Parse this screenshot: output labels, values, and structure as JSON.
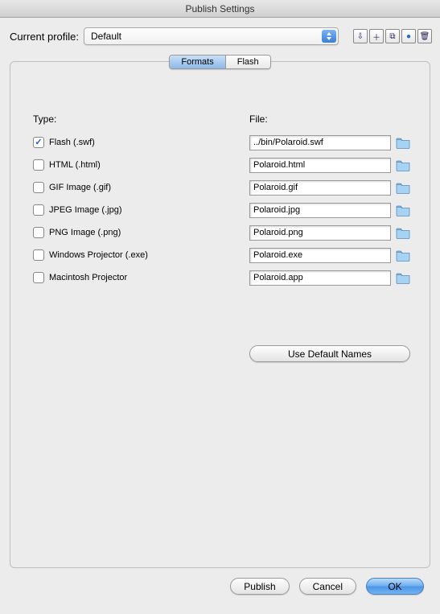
{
  "window": {
    "title": "Publish Settings"
  },
  "profile": {
    "label": "Current profile:",
    "selected": "Default"
  },
  "toolbar_icons": [
    "import",
    "add",
    "duplicate",
    "info",
    "delete"
  ],
  "tabs": {
    "items": [
      "Formats",
      "Flash"
    ],
    "active": 0
  },
  "headers": {
    "type": "Type:",
    "file": "File:"
  },
  "rows": [
    {
      "checked": true,
      "label": "Flash (.swf)",
      "file": "../bin/Polaroid.swf"
    },
    {
      "checked": false,
      "label": "HTML (.html)",
      "file": "Polaroid.html"
    },
    {
      "checked": false,
      "label": "GIF Image (.gif)",
      "file": "Polaroid.gif"
    },
    {
      "checked": false,
      "label": "JPEG Image (.jpg)",
      "file": "Polaroid.jpg"
    },
    {
      "checked": false,
      "label": "PNG Image (.png)",
      "file": "Polaroid.png"
    },
    {
      "checked": false,
      "label": "Windows Projector (.exe)",
      "file": "Polaroid.exe"
    },
    {
      "checked": false,
      "label": "Macintosh Projector",
      "file": "Polaroid.app"
    }
  ],
  "buttons": {
    "use_default": "Use Default Names",
    "publish": "Publish",
    "cancel": "Cancel",
    "ok": "OK"
  }
}
